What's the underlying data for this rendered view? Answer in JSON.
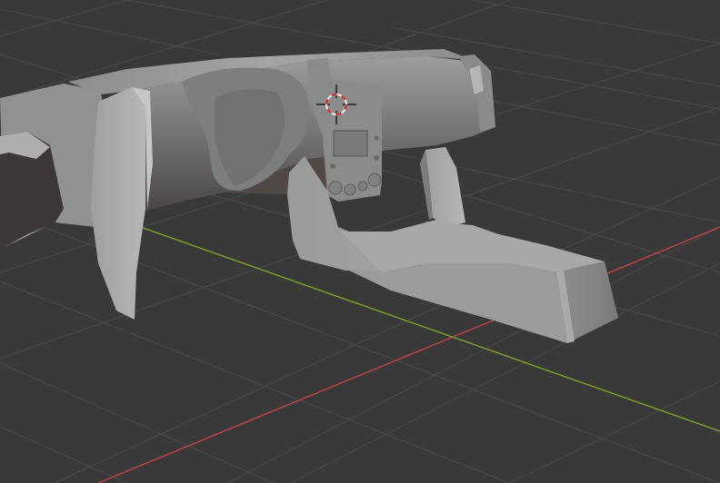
{
  "viewport": {
    "background_color": "#393939",
    "grid_color": "#4a4a4a",
    "x_axis_color": "#c4414a",
    "y_axis_color": "#7fa22a",
    "model_name": "car-dashboard-model",
    "model_color": "#8f9090",
    "cursor_icon": "3d-cursor-icon",
    "cursor_colors": [
      "#e8e8e8",
      "#d22d2d"
    ]
  }
}
